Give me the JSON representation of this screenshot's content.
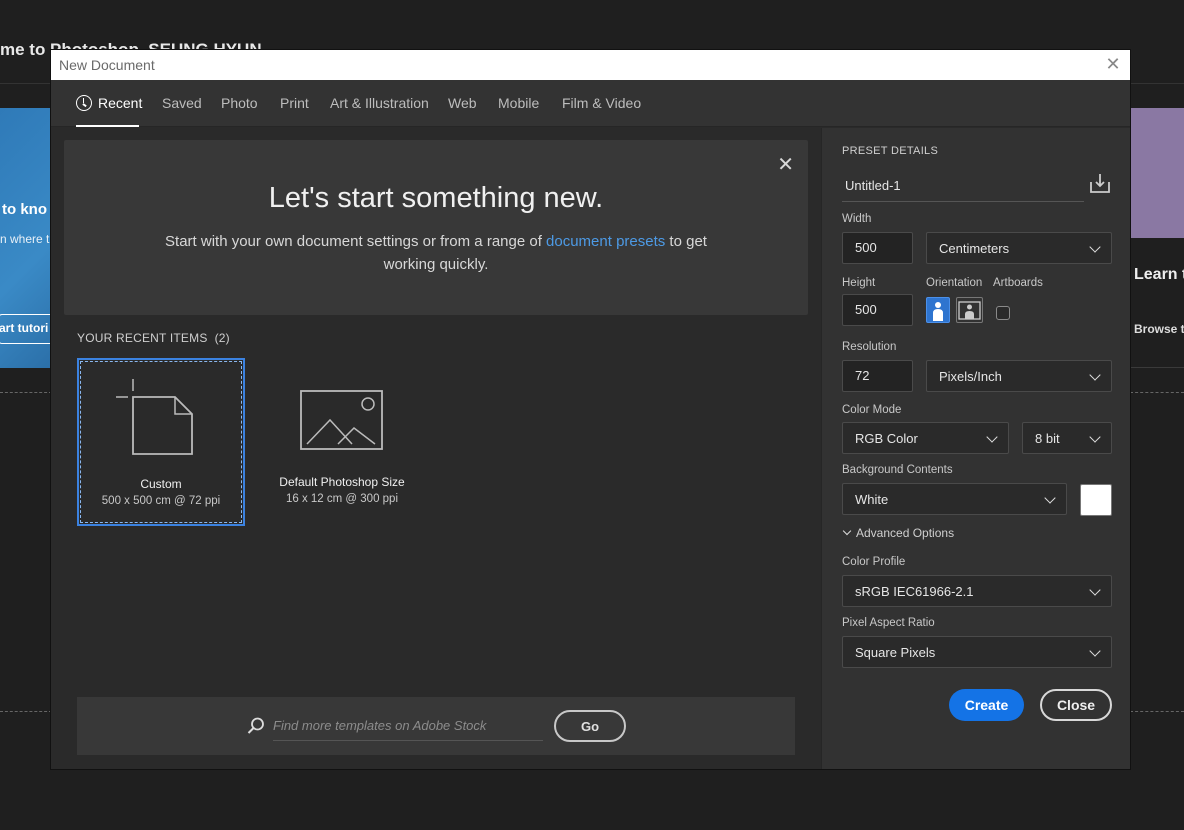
{
  "background": {
    "welcome_text": "me to Photoshop, SEUNG HYUN",
    "left_card_title": "to kno",
    "left_card_sub": "n where t",
    "left_card_button": "art tutori",
    "right_card_title": "Learn t",
    "right_card_link": "Browse t"
  },
  "dialog": {
    "title": "New Document",
    "close_glyph": "✕",
    "tabs": [
      {
        "label": "Recent"
      },
      {
        "label": "Saved"
      },
      {
        "label": "Photo"
      },
      {
        "label": "Print"
      },
      {
        "label": "Art & Illustration"
      },
      {
        "label": "Web"
      },
      {
        "label": "Mobile"
      },
      {
        "label": "Film & Video"
      }
    ],
    "hero": {
      "close_glyph": "✕",
      "title": "Let's start something new.",
      "sub_before": "Start with your own document settings or from a range of ",
      "sub_link": "document presets",
      "sub_after": " to get working quickly."
    },
    "recent_label": "YOUR RECENT ITEMS",
    "recent_count": "(2)",
    "recent_items": [
      {
        "name": "Custom",
        "desc": "500 x 500 cm @ 72 ppi",
        "icon": "new-document-icon"
      },
      {
        "name": "Default Photoshop Size",
        "desc": "16 x 12 cm @ 300 ppi",
        "icon": "image-icon"
      }
    ],
    "search": {
      "placeholder": "Find more templates on Adobe Stock",
      "go_label": "Go"
    }
  },
  "preset": {
    "section_title": "PRESET DETAILS",
    "name": "Untitled-1",
    "width_label": "Width",
    "width_value": "500",
    "width_unit": "Centimeters",
    "height_label": "Height",
    "height_value": "500",
    "orientation_label": "Orientation",
    "artboards_label": "Artboards",
    "orientation_selected": "portrait",
    "artboards_checked": false,
    "resolution_label": "Resolution",
    "resolution_value": "72",
    "resolution_unit": "Pixels/Inch",
    "color_mode_label": "Color Mode",
    "color_mode": "RGB Color",
    "bit_depth": "8 bit",
    "bg_contents_label": "Background Contents",
    "bg_contents": "White",
    "bg_swatch_color": "#ffffff",
    "advanced_label": "Advanced Options",
    "color_profile_label": "Color Profile",
    "color_profile": "sRGB IEC61966-2.1",
    "pixel_aspect_label": "Pixel Aspect Ratio",
    "pixel_aspect": "Square Pixels",
    "create_label": "Create",
    "close_label": "Close"
  },
  "colors": {
    "accent": "#1473e6",
    "link": "#4d9ae5",
    "selection": "#3b82e0"
  }
}
